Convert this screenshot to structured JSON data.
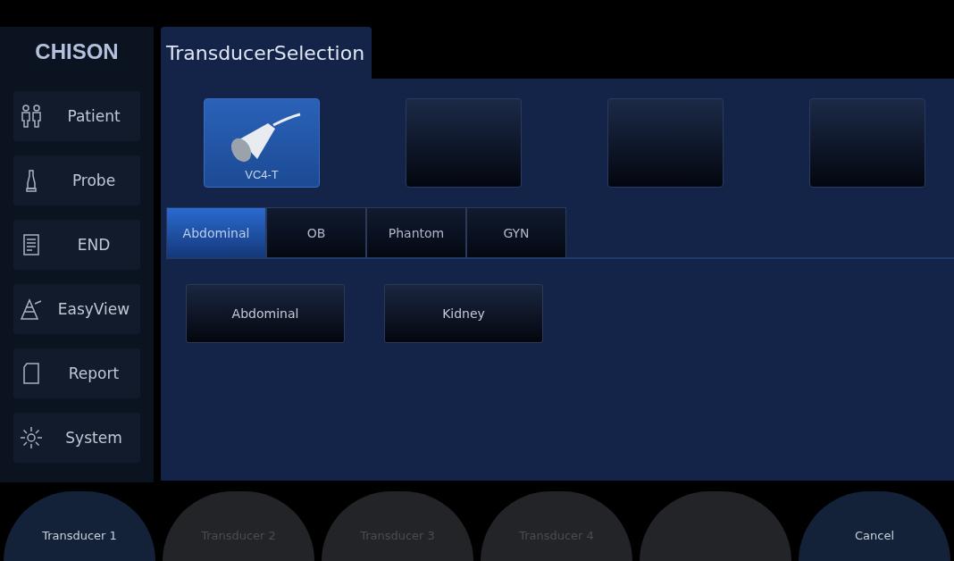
{
  "logo": "CHISON",
  "sidebar": {
    "items": [
      {
        "label": "Patient",
        "kind": "people"
      },
      {
        "label": "Probe",
        "kind": "probe"
      },
      {
        "label": "END",
        "kind": "document"
      },
      {
        "label": "EasyView",
        "kind": "easyview"
      },
      {
        "label": "Report",
        "kind": "page"
      },
      {
        "label": "System",
        "kind": "gear"
      }
    ]
  },
  "panel": {
    "title": "TransducerSelection"
  },
  "transducers": [
    {
      "label": "VC4-T",
      "selected": true
    },
    {
      "selected": false
    },
    {
      "selected": false
    },
    {
      "selected": false
    }
  ],
  "exam_tabs": [
    {
      "label": "Abdominal",
      "selected": true
    },
    {
      "label": "OB",
      "selected": false
    },
    {
      "label": "Phantom",
      "selected": false
    },
    {
      "label": "GYN",
      "selected": false
    }
  ],
  "presets": [
    "Abdominal",
    "Kidney"
  ],
  "soft_keys": [
    {
      "label": "Transducer 1",
      "disabled": false
    },
    {
      "label": "Transducer 2",
      "disabled": true
    },
    {
      "label": "Transducer 3",
      "disabled": true
    },
    {
      "label": "Transducer 4",
      "disabled": true
    },
    {
      "disabled": true
    },
    {
      "label": "Cancel",
      "disabled": false
    }
  ]
}
